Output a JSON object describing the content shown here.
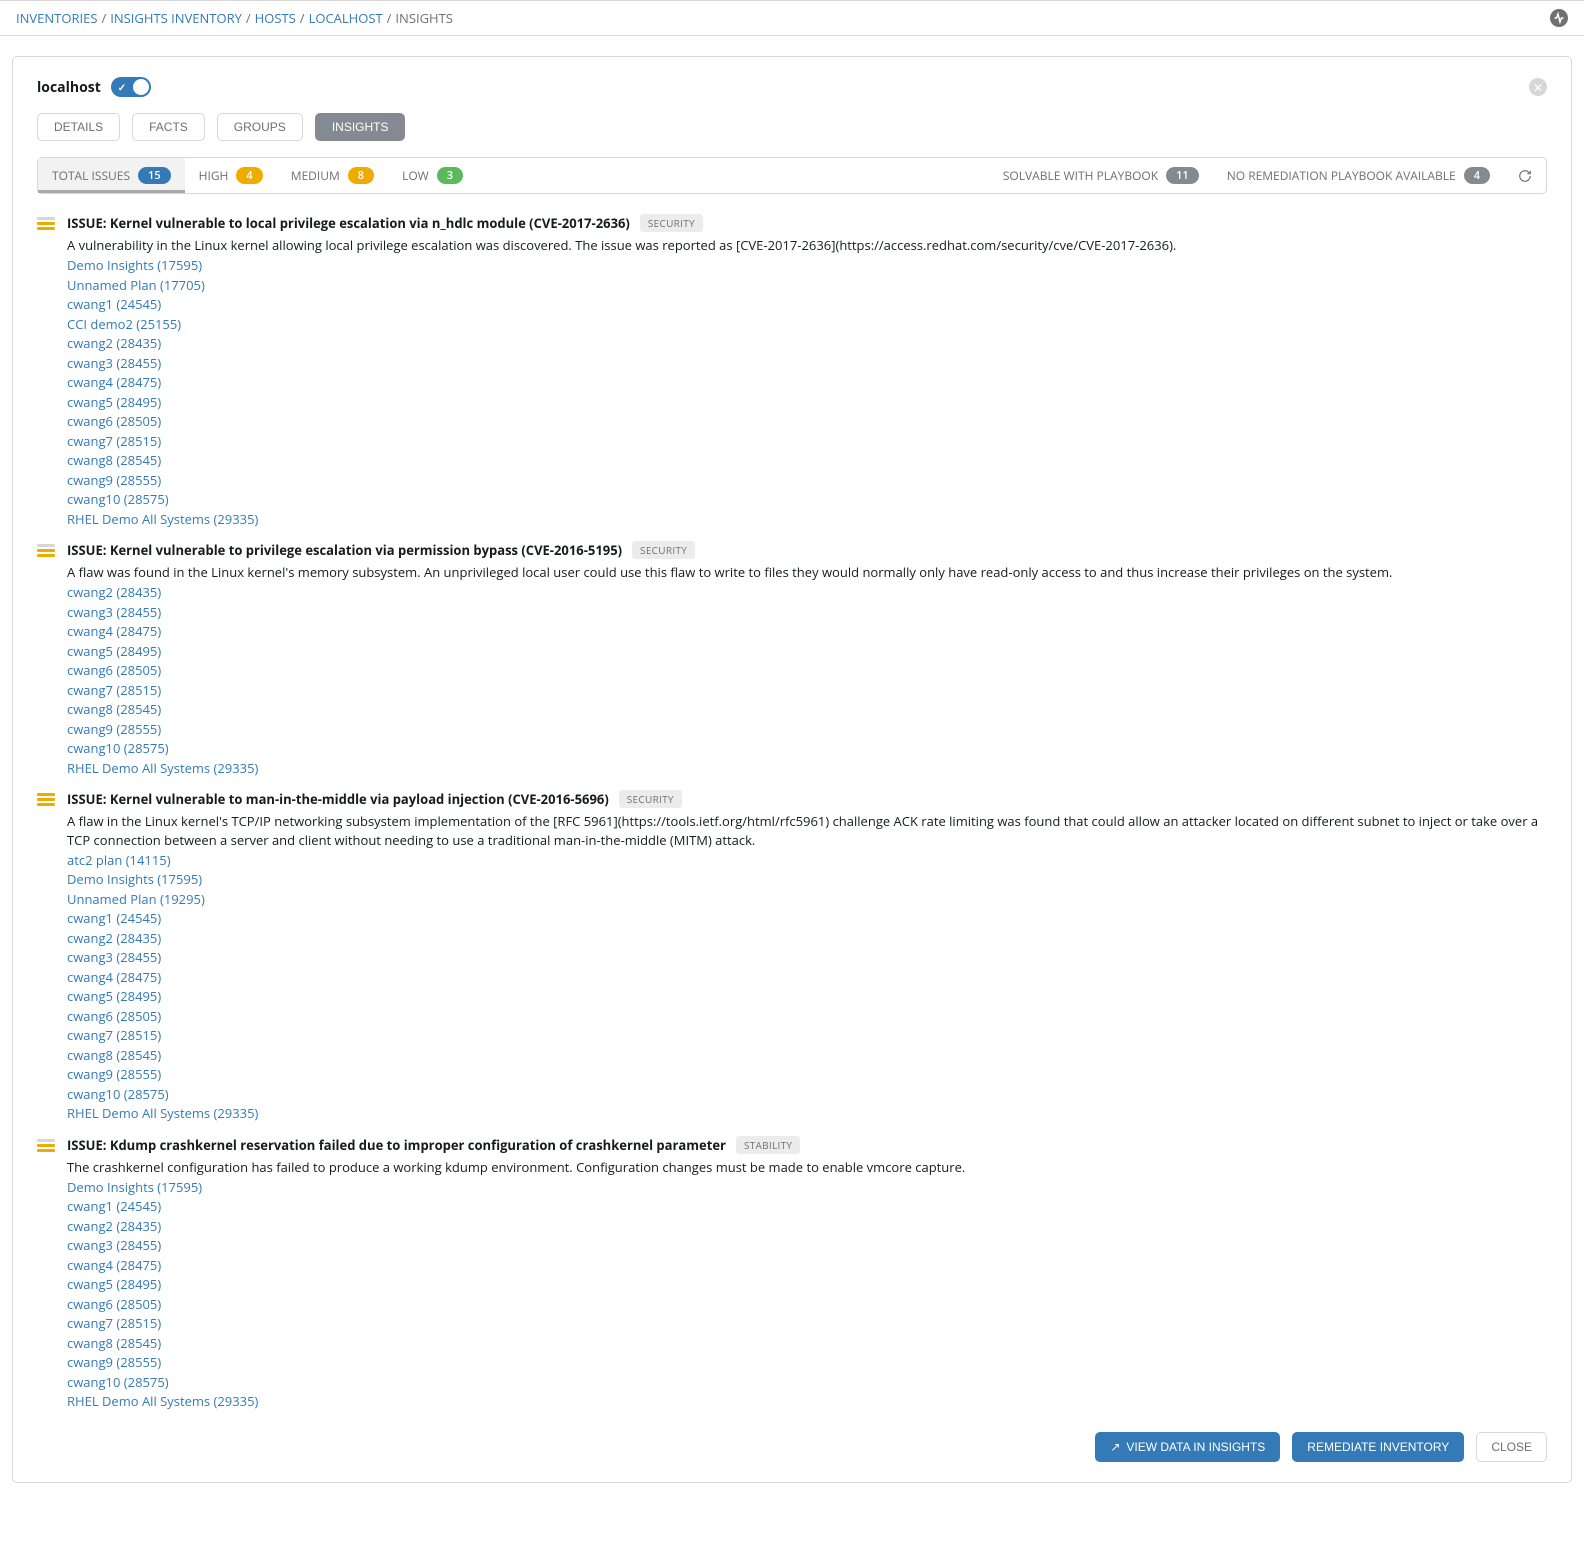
{
  "breadcrumb": {
    "items": [
      {
        "label": "INVENTORIES",
        "link": true
      },
      {
        "label": "Insights Inventory",
        "link": true
      },
      {
        "label": "HOSTS",
        "link": true
      },
      {
        "label": "localhost",
        "link": true
      },
      {
        "label": "INSIGHTS",
        "link": false
      }
    ]
  },
  "panel": {
    "title": "localhost"
  },
  "tabs": [
    {
      "label": "DETAILS",
      "active": false
    },
    {
      "label": "FACTS",
      "active": false
    },
    {
      "label": "GROUPS",
      "active": false
    },
    {
      "label": "INSIGHTS",
      "active": true
    }
  ],
  "filters": {
    "left": [
      {
        "label": "TOTAL ISSUES",
        "count": "15",
        "color": "b-blue",
        "active": true
      },
      {
        "label": "HIGH",
        "count": "4",
        "color": "b-orange",
        "active": false
      },
      {
        "label": "MEDIUM",
        "count": "8",
        "color": "b-yellow",
        "active": false
      },
      {
        "label": "LOW",
        "count": "3",
        "color": "b-green",
        "active": false
      }
    ],
    "right": [
      {
        "label": "SOLVABLE WITH PLAYBOOK",
        "count": "11",
        "color": "b-gray"
      },
      {
        "label": "NO REMEDIATION PLAYBOOK AVAILABLE",
        "count": "4",
        "color": "b-gray"
      }
    ]
  },
  "issues": [
    {
      "severity": "low",
      "title": "ISSUE: Kernel vulnerable to local privilege escalation via n_hdlc module (CVE-2017-2636)",
      "tag": "SECURITY",
      "desc": "A vulnerability in the Linux kernel allowing local privilege escalation was discovered. The issue was reported as [CVE-2017-2636](https://access.redhat.com/security/cve/CVE-2017-2636).",
      "links": [
        "Demo Insights (17595)",
        "Unnamed Plan (17705)",
        "cwang1 (24545)",
        "CCI demo2 (25155)",
        "cwang2 (28435)",
        "cwang3 (28455)",
        "cwang4 (28475)",
        "cwang5 (28495)",
        "cwang6 (28505)",
        "cwang7 (28515)",
        "cwang8 (28545)",
        "cwang9 (28555)",
        "cwang10 (28575)",
        "RHEL Demo All Systems (29335)"
      ]
    },
    {
      "severity": "low",
      "title": "ISSUE: Kernel vulnerable to privilege escalation via permission bypass (CVE-2016-5195)",
      "tag": "SECURITY",
      "desc": "A flaw was found in the Linux kernel's memory subsystem. An unprivileged local user could use this flaw to write to files they would normally only have read-only access to and thus increase their privileges on the system.",
      "links": [
        "cwang2 (28435)",
        "cwang3 (28455)",
        "cwang4 (28475)",
        "cwang5 (28495)",
        "cwang6 (28505)",
        "cwang7 (28515)",
        "cwang8 (28545)",
        "cwang9 (28555)",
        "cwang10 (28575)",
        "RHEL Demo All Systems (29335)"
      ]
    },
    {
      "severity": "med",
      "title": "ISSUE: Kernel vulnerable to man-in-the-middle via payload injection (CVE-2016-5696)",
      "tag": "SECURITY",
      "desc": "A flaw in the Linux kernel's TCP/IP networking subsystem implementation of the [RFC 5961](https://tools.ietf.org/html/rfc5961) challenge ACK rate limiting was found that could allow an attacker located on different subnet to inject or take over a TCP connection between a server and client without needing to use a traditional man-in-the-middle (MITM) attack.",
      "links": [
        "atc2 plan (14115)",
        "Demo Insights (17595)",
        "Unnamed Plan (19295)",
        "cwang1 (24545)",
        "cwang2 (28435)",
        "cwang3 (28455)",
        "cwang4 (28475)",
        "cwang5 (28495)",
        "cwang6 (28505)",
        "cwang7 (28515)",
        "cwang8 (28545)",
        "cwang9 (28555)",
        "cwang10 (28575)",
        "RHEL Demo All Systems (29335)"
      ]
    },
    {
      "severity": "low",
      "title": "ISSUE: Kdump crashkernel reservation failed due to improper configuration of crashkernel parameter",
      "tag": "STABILITY",
      "desc": "The crashkernel configuration has failed to produce a working kdump environment. Configuration changes must be made to enable vmcore capture.",
      "links": [
        "Demo Insights (17595)",
        "cwang1 (24545)",
        "cwang2 (28435)",
        "cwang3 (28455)",
        "cwang4 (28475)",
        "cwang5 (28495)",
        "cwang6 (28505)",
        "cwang7 (28515)",
        "cwang8 (28545)",
        "cwang9 (28555)",
        "cwang10 (28575)",
        "RHEL Demo All Systems (29335)"
      ]
    }
  ],
  "footer": {
    "view_label": "VIEW DATA IN INSIGHTS",
    "remediate_label": "REMEDIATE INVENTORY",
    "close_label": "CLOSE"
  }
}
